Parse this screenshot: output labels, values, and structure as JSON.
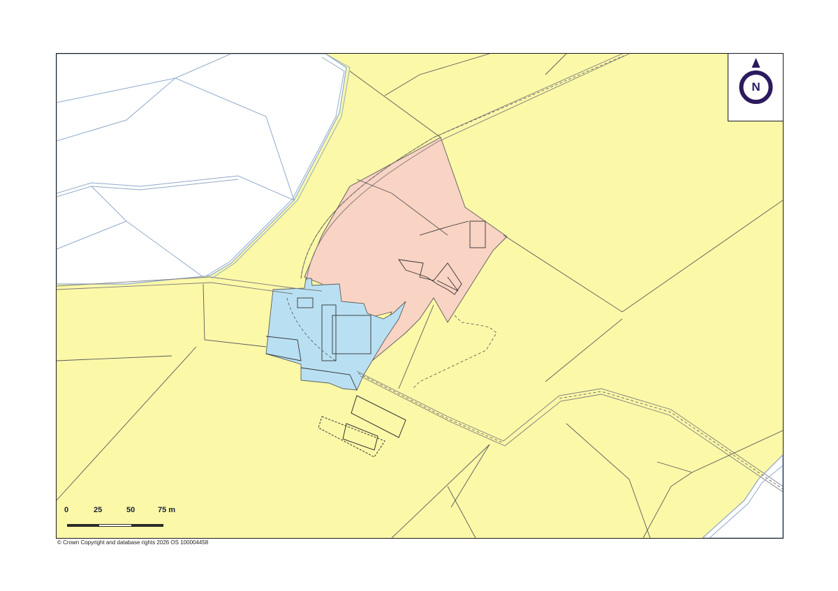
{
  "map": {
    "colors": {
      "background": "#ffffff",
      "field": "#fbf8a8",
      "site_pink": "#f9d3c3",
      "site_blue": "#b9e0f2",
      "parcel_line": "#5a5a5a",
      "water_line": "#8fa9c9",
      "brand": "#2c1a5e"
    },
    "north_arrow": {
      "label": "N",
      "icon": "north-arrow-icon"
    },
    "scale_bar": {
      "labels": [
        "0",
        "25",
        "50",
        "75 m"
      ]
    },
    "copyright": "© Crown Copyright and database rights 2026 OS 100004458"
  }
}
